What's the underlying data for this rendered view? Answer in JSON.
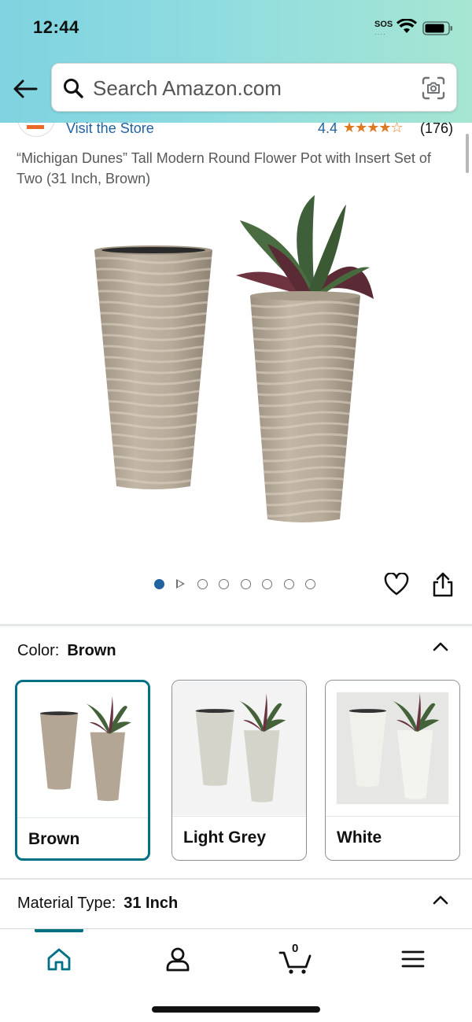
{
  "status_bar": {
    "time": "12:44",
    "sos": "SOS"
  },
  "search": {
    "placeholder": "Search Amazon.com"
  },
  "store": {
    "visit_label": "Visit the Store",
    "rating": "4.4",
    "stars": "★★★★☆",
    "review_count": "(176)"
  },
  "product": {
    "title": "“Michigan Dunes” Tall Modern Round Flower Pot with Insert Set of Two (31 Inch, Brown)",
    "image_count": 8,
    "active_image_index": 0
  },
  "color": {
    "label": "Color:",
    "selected": "Brown",
    "options": [
      {
        "label": "Brown",
        "selected": true,
        "color": "#b5a897"
      },
      {
        "label": "Light Grey",
        "selected": false,
        "color": "#d5d5cd"
      },
      {
        "label": "White",
        "selected": false,
        "color": "#ecece6"
      }
    ]
  },
  "material": {
    "label": "Material Type:",
    "selected": "31 Inch"
  },
  "bottom_nav": {
    "cart_count": "0",
    "active": "home"
  },
  "colors": {
    "accent": "#007185",
    "link": "#2162a1",
    "star": "#de7921"
  }
}
